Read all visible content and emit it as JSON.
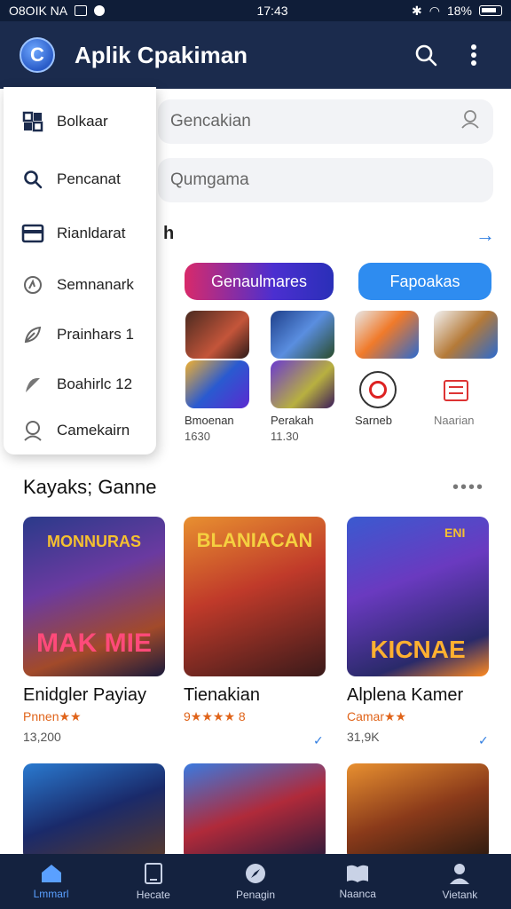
{
  "status_bar": {
    "left_text": "O8OIK NA",
    "time": "17:43",
    "battery": "18%"
  },
  "app_bar": {
    "title": "Aplik Cpakiman",
    "logo_glyph": "C",
    "icons": [
      "search-icon",
      "more-vert-icon"
    ]
  },
  "search": {
    "field1": "Gencakian",
    "field2": "Qumgama"
  },
  "drawer": {
    "items": [
      {
        "label": "Bolkaar",
        "icon": "grid-icon"
      },
      {
        "label": "Pencanat",
        "icon": "search-icon"
      },
      {
        "label": "Rianldarat",
        "icon": "card-icon"
      },
      {
        "label": "Semnanark",
        "icon": "gauge-icon"
      },
      {
        "label": "Prainhars 1",
        "icon": "leaf-icon"
      },
      {
        "label": "Boahirlc 12",
        "icon": "feather-icon"
      },
      {
        "label": "Camekairn",
        "icon": "user-icon"
      }
    ]
  },
  "section": {
    "title_suffix": "h",
    "arrow": "→"
  },
  "pills": {
    "a": "Genaulmares",
    "b": "Fapoakas"
  },
  "mini_apps": [
    {
      "label": "Bmoenan",
      "count": "1630",
      "icon": "download-icon"
    },
    {
      "label": "Perakah",
      "count": "11.30",
      "icon": "download-icon"
    },
    {
      "label": "Sarneb",
      "count": "",
      "icon": "target-icon"
    },
    {
      "label": "Naarian",
      "count": "",
      "icon": "news-icon"
    }
  ],
  "games_section": {
    "title": "Kayaks; Ganne",
    "more": "••••"
  },
  "games": [
    {
      "name": "Enidgler Payiay",
      "sub": "Pnnen★★",
      "count": "13,200",
      "art_title": "MAK MIE",
      "art_top": "MONNURAS"
    },
    {
      "name": "Tienakian",
      "sub": "9★★★★ 8",
      "count": "",
      "art_title": "",
      "art_top": "BLANIACAN"
    },
    {
      "name": "Alplena Kamer",
      "sub": "Camar★★",
      "count": "31,9K",
      "art_title": "KICNAE",
      "art_top": "ENI"
    }
  ],
  "bottom_nav": [
    {
      "label": "Lmmarl",
      "icon": "home-icon",
      "active": true
    },
    {
      "label": "Hecate",
      "icon": "tablet-icon",
      "active": false
    },
    {
      "label": "Penagin",
      "icon": "compass-icon",
      "active": false
    },
    {
      "label": "Naanca",
      "icon": "book-icon",
      "active": false
    },
    {
      "label": "Vietank",
      "icon": "person-icon",
      "active": false
    }
  ],
  "colors": {
    "app_bar": "#1b2b4d",
    "accent": "#2f7de1",
    "rating": "#e0641a"
  }
}
